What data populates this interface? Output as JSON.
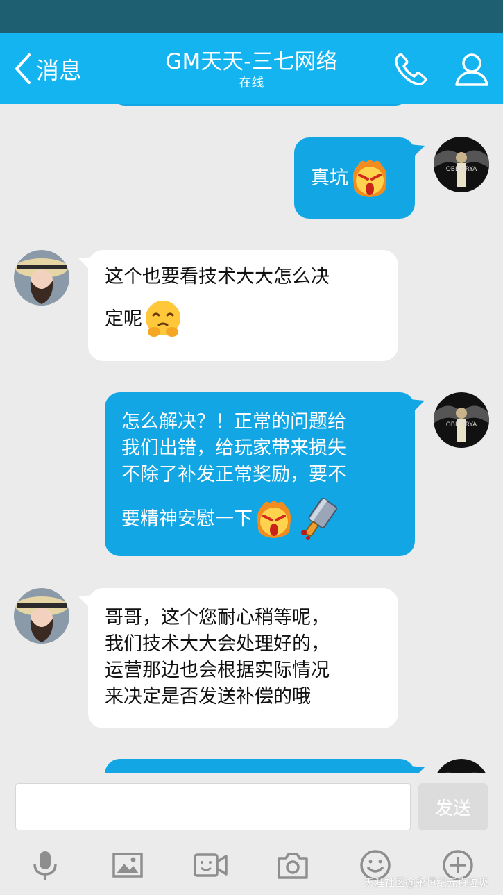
{
  "header": {
    "back_label": "消息",
    "title": "GM天天-三七网络",
    "subtitle": "在线"
  },
  "messages": [
    {
      "direction": "out",
      "text": "真坑"
    },
    {
      "direction": "in",
      "line1": "这个也要看技术大大怎么决",
      "line2": "定呢"
    },
    {
      "direction": "out",
      "lines": [
        "怎么解决？！正常的问题给",
        "我们出错，给玩家带来损失",
        "不除了补发正常奖励，要不"
      ],
      "last_line": "要精神安慰一下"
    },
    {
      "direction": "in",
      "lines": [
        "哥哥，这个您耐心稍等呢，",
        "我们技术大大会处理好的，",
        "运营那边也会根据实际情况",
        "来决定是否发送补偿的哦"
      ]
    }
  ],
  "input": {
    "value": "",
    "placeholder": ""
  },
  "send_label": "发送",
  "toolbar_icons": [
    "mic-icon",
    "image-icon",
    "video-call-icon",
    "camera-icon",
    "emoji-icon",
    "plus-icon"
  ],
  "watermark": "天涯社区@永恒纪元真垃圾",
  "colors": {
    "header": "#13b4f0",
    "status_bar": "#1f5f72",
    "outgoing_bubble": "#12a6e5",
    "incoming_bubble": "#ffffff",
    "background": "#ebebeb"
  }
}
